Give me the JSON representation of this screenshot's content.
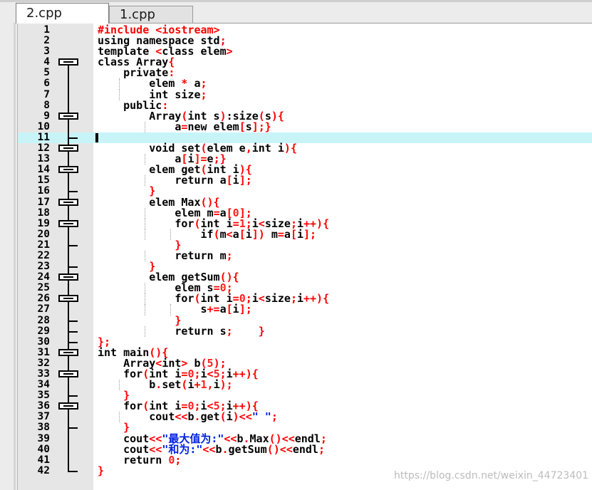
{
  "tabs": [
    {
      "label": "2.cpp",
      "active": true
    },
    {
      "label": "1.cpp",
      "active": false
    }
  ],
  "current_line": 11,
  "code_lines": [
    {
      "n": "1",
      "parts": [
        [
          "r",
          "#include <iostream>"
        ]
      ],
      "fold": "none"
    },
    {
      "n": "2",
      "parts": [
        [
          "k",
          "using namespace std"
        ],
        [
          "r",
          ";"
        ]
      ],
      "fold": "none"
    },
    {
      "n": "3",
      "parts": [
        [
          "k",
          "template "
        ],
        [
          "r",
          "<"
        ],
        [
          "k",
          "class elem"
        ],
        [
          "r",
          ">"
        ]
      ],
      "fold": "none"
    },
    {
      "n": "4",
      "parts": [
        [
          "k",
          "class Array"
        ],
        [
          "r",
          "{"
        ]
      ],
      "fold": "start"
    },
    {
      "n": "5",
      "parts": [
        [
          "k",
          "    private"
        ],
        [
          "r",
          ":"
        ]
      ],
      "fold": "line"
    },
    {
      "n": "6",
      "parts": [
        [
          "k",
          "        elem "
        ],
        [
          "r",
          "*"
        ],
        [
          "k",
          " a"
        ],
        [
          "r",
          ";"
        ]
      ],
      "fold": "line"
    },
    {
      "n": "7",
      "parts": [
        [
          "k",
          "        int size"
        ],
        [
          "r",
          ";"
        ]
      ],
      "fold": "line"
    },
    {
      "n": "8",
      "parts": [
        [
          "k",
          "    public"
        ],
        [
          "r",
          ":"
        ]
      ],
      "fold": "line"
    },
    {
      "n": "9",
      "parts": [
        [
          "k",
          "        Array"
        ],
        [
          "r",
          "("
        ],
        [
          "k",
          "int s"
        ],
        [
          "r",
          ")"
        ],
        [
          "k",
          ":size"
        ],
        [
          "r",
          "("
        ],
        [
          "k",
          "s"
        ],
        [
          "r",
          ")"
        ],
        [
          "r",
          "{"
        ]
      ],
      "fold": "start"
    },
    {
      "n": "10",
      "parts": [
        [
          "k",
          "            a"
        ],
        [
          "r",
          "="
        ],
        [
          "k",
          "new elem"
        ],
        [
          "r",
          "["
        ],
        [
          "k",
          "s"
        ],
        [
          "r",
          "]"
        ],
        [
          "r",
          ";}"
        ]
      ],
      "fold": "line"
    },
    {
      "n": "11",
      "parts": [],
      "fold": "end"
    },
    {
      "n": "12",
      "parts": [
        [
          "k",
          "        void set"
        ],
        [
          "r",
          "("
        ],
        [
          "k",
          "elem e"
        ],
        [
          "r",
          ","
        ],
        [
          "k",
          "int i"
        ],
        [
          "r",
          ")"
        ],
        [
          "r",
          "{"
        ]
      ],
      "fold": "start"
    },
    {
      "n": "13",
      "parts": [
        [
          "k",
          "            a"
        ],
        [
          "r",
          "["
        ],
        [
          "k",
          "i"
        ],
        [
          "r",
          "]"
        ],
        [
          "r",
          "="
        ],
        [
          "k",
          "e"
        ],
        [
          "r",
          ";}"
        ]
      ],
      "fold": "line"
    },
    {
      "n": "14",
      "parts": [
        [
          "k",
          "        elem get"
        ],
        [
          "r",
          "("
        ],
        [
          "k",
          "int i"
        ],
        [
          "r",
          ")"
        ],
        [
          "r",
          "{"
        ]
      ],
      "fold": "start"
    },
    {
      "n": "15",
      "parts": [
        [
          "k",
          "            return a"
        ],
        [
          "r",
          "["
        ],
        [
          "k",
          "i"
        ],
        [
          "r",
          "]"
        ],
        [
          "r",
          ";"
        ]
      ],
      "fold": "line"
    },
    {
      "n": "16",
      "parts": [
        [
          "r",
          "        }"
        ]
      ],
      "fold": "end"
    },
    {
      "n": "17",
      "parts": [
        [
          "k",
          "        elem Max"
        ],
        [
          "r",
          "(){"
        ]
      ],
      "fold": "start"
    },
    {
      "n": "18",
      "parts": [
        [
          "k",
          "            elem m"
        ],
        [
          "r",
          "="
        ],
        [
          "k",
          "a"
        ],
        [
          "r",
          "["
        ],
        [
          "p",
          "0"
        ],
        [
          "r",
          "]"
        ],
        [
          "r",
          ";"
        ]
      ],
      "fold": "line"
    },
    {
      "n": "19",
      "parts": [
        [
          "k",
          "            for"
        ],
        [
          "r",
          "("
        ],
        [
          "k",
          "int i"
        ],
        [
          "r",
          "="
        ],
        [
          "p",
          "1"
        ],
        [
          "r",
          ";"
        ],
        [
          "k",
          "i"
        ],
        [
          "r",
          "<"
        ],
        [
          "k",
          "size"
        ],
        [
          "r",
          ";"
        ],
        [
          "k",
          "i"
        ],
        [
          "r",
          "++){"
        ]
      ],
      "fold": "start"
    },
    {
      "n": "20",
      "parts": [
        [
          "k",
          "                if"
        ],
        [
          "r",
          "("
        ],
        [
          "k",
          "m"
        ],
        [
          "r",
          "<"
        ],
        [
          "k",
          "a"
        ],
        [
          "r",
          "["
        ],
        [
          "k",
          "i"
        ],
        [
          "r",
          "]) "
        ],
        [
          "k",
          "m"
        ],
        [
          "r",
          "="
        ],
        [
          "k",
          "a"
        ],
        [
          "r",
          "["
        ],
        [
          "k",
          "i"
        ],
        [
          "r",
          "]"
        ],
        [
          "r",
          ";"
        ]
      ],
      "fold": "line"
    },
    {
      "n": "21",
      "parts": [
        [
          "r",
          "            }"
        ]
      ],
      "fold": "end"
    },
    {
      "n": "22",
      "parts": [
        [
          "k",
          "            return m"
        ],
        [
          "r",
          ";"
        ]
      ],
      "fold": "line"
    },
    {
      "n": "23",
      "parts": [
        [
          "r",
          "        }"
        ]
      ],
      "fold": "end"
    },
    {
      "n": "24",
      "parts": [
        [
          "k",
          "        elem getSum"
        ],
        [
          "r",
          "(){"
        ]
      ],
      "fold": "start"
    },
    {
      "n": "25",
      "parts": [
        [
          "k",
          "            elem s"
        ],
        [
          "r",
          "="
        ],
        [
          "p",
          "0"
        ],
        [
          "r",
          ";"
        ]
      ],
      "fold": "line"
    },
    {
      "n": "26",
      "parts": [
        [
          "k",
          "            for"
        ],
        [
          "r",
          "("
        ],
        [
          "k",
          "int i"
        ],
        [
          "r",
          "="
        ],
        [
          "p",
          "0"
        ],
        [
          "r",
          ";"
        ],
        [
          "k",
          "i"
        ],
        [
          "r",
          "<"
        ],
        [
          "k",
          "size"
        ],
        [
          "r",
          ";"
        ],
        [
          "k",
          "i"
        ],
        [
          "r",
          "++){"
        ]
      ],
      "fold": "start"
    },
    {
      "n": "27",
      "parts": [
        [
          "k",
          "                s"
        ],
        [
          "r",
          "+="
        ],
        [
          "k",
          "a"
        ],
        [
          "r",
          "["
        ],
        [
          "k",
          "i"
        ],
        [
          "r",
          "]"
        ],
        [
          "r",
          ";"
        ]
      ],
      "fold": "line"
    },
    {
      "n": "28",
      "parts": [
        [
          "r",
          "            }"
        ]
      ],
      "fold": "end"
    },
    {
      "n": "29",
      "parts": [
        [
          "k",
          "            return s"
        ],
        [
          "r",
          ";"
        ],
        [
          "k",
          "    "
        ],
        [
          "r",
          "}"
        ]
      ],
      "fold": "end"
    },
    {
      "n": "30",
      "parts": [
        [
          "r",
          "};"
        ]
      ],
      "fold": "end"
    },
    {
      "n": "31",
      "parts": [
        [
          "k",
          "int main"
        ],
        [
          "r",
          "(){"
        ]
      ],
      "fold": "start"
    },
    {
      "n": "32",
      "parts": [
        [
          "k",
          "    Array"
        ],
        [
          "r",
          "<"
        ],
        [
          "k",
          "int"
        ],
        [
          "r",
          "> "
        ],
        [
          "k",
          "b"
        ],
        [
          "r",
          "("
        ],
        [
          "p",
          "5"
        ],
        [
          "r",
          ")"
        ],
        [
          "r",
          ";"
        ]
      ],
      "fold": "line"
    },
    {
      "n": "33",
      "parts": [
        [
          "k",
          "    for"
        ],
        [
          "r",
          "("
        ],
        [
          "k",
          "int i"
        ],
        [
          "r",
          "="
        ],
        [
          "p",
          "0"
        ],
        [
          "r",
          ";"
        ],
        [
          "k",
          "i"
        ],
        [
          "r",
          "<"
        ],
        [
          "p",
          "5"
        ],
        [
          "r",
          ";"
        ],
        [
          "k",
          "i"
        ],
        [
          "r",
          "++){"
        ]
      ],
      "fold": "start"
    },
    {
      "n": "34",
      "parts": [
        [
          "k",
          "        b"
        ],
        [
          "r",
          "."
        ],
        [
          "k",
          "set"
        ],
        [
          "r",
          "("
        ],
        [
          "k",
          "i"
        ],
        [
          "r",
          "+"
        ],
        [
          "p",
          "1"
        ],
        [
          "r",
          ","
        ],
        [
          "k",
          "i"
        ],
        [
          "r",
          ")"
        ],
        [
          "r",
          ";"
        ]
      ],
      "fold": "line"
    },
    {
      "n": "35",
      "parts": [
        [
          "r",
          "    }"
        ]
      ],
      "fold": "end"
    },
    {
      "n": "36",
      "parts": [
        [
          "k",
          "    for"
        ],
        [
          "r",
          "("
        ],
        [
          "k",
          "int i"
        ],
        [
          "r",
          "="
        ],
        [
          "p",
          "0"
        ],
        [
          "r",
          ";"
        ],
        [
          "k",
          "i"
        ],
        [
          "r",
          "<"
        ],
        [
          "p",
          "5"
        ],
        [
          "r",
          ";"
        ],
        [
          "k",
          "i"
        ],
        [
          "r",
          "++){"
        ]
      ],
      "fold": "start"
    },
    {
      "n": "37",
      "parts": [
        [
          "k",
          "        cout"
        ],
        [
          "r",
          "<<"
        ],
        [
          "k",
          "b"
        ],
        [
          "r",
          "."
        ],
        [
          "k",
          "get"
        ],
        [
          "r",
          "("
        ],
        [
          "k",
          "i"
        ],
        [
          "r",
          ")<<"
        ],
        [
          "s",
          "\" \""
        ],
        [
          "r",
          ";"
        ]
      ],
      "fold": "line"
    },
    {
      "n": "38",
      "parts": [
        [
          "r",
          "    }"
        ]
      ],
      "fold": "end"
    },
    {
      "n": "39",
      "parts": [
        [
          "k",
          "    cout"
        ],
        [
          "r",
          "<<"
        ],
        [
          "s",
          "\"最大值为:\""
        ],
        [
          "r",
          "<<"
        ],
        [
          "k",
          "b"
        ],
        [
          "r",
          "."
        ],
        [
          "k",
          "Max"
        ],
        [
          "r",
          "()<<"
        ],
        [
          "k",
          "endl"
        ],
        [
          "r",
          ";"
        ]
      ],
      "fold": "line"
    },
    {
      "n": "40",
      "parts": [
        [
          "k",
          "    cout"
        ],
        [
          "r",
          "<<"
        ],
        [
          "s",
          "\"和为:\""
        ],
        [
          "r",
          "<<"
        ],
        [
          "k",
          "b"
        ],
        [
          "r",
          "."
        ],
        [
          "k",
          "getSum"
        ],
        [
          "r",
          "()<<"
        ],
        [
          "k",
          "endl"
        ],
        [
          "r",
          ";"
        ]
      ],
      "fold": "line"
    },
    {
      "n": "41",
      "parts": [
        [
          "k",
          "    return "
        ],
        [
          "p",
          "0"
        ],
        [
          "r",
          ";"
        ]
      ],
      "fold": "line"
    },
    {
      "n": "42",
      "parts": [
        [
          "r",
          "}"
        ]
      ],
      "fold": "end"
    }
  ],
  "watermark": "https://blog.csdn.net/weixin_44723401"
}
